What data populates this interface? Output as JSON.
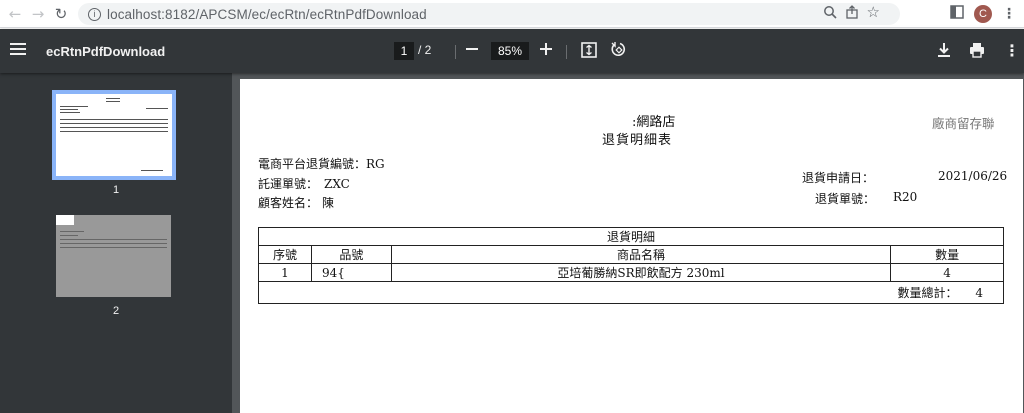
{
  "browser": {
    "url": "localhost:8182/APCSM/ec/ecRtn/ecRtnPdfDownload",
    "avatar_letter": "C"
  },
  "pdf_toolbar": {
    "title": "ecRtnPdfDownload",
    "current_page": "1",
    "total_pages": "/ 2",
    "zoom": "85%"
  },
  "sidebar": {
    "thumbnails": [
      {
        "label": "1",
        "selected": true
      },
      {
        "label": "2",
        "selected": false
      }
    ]
  },
  "document": {
    "store_name": ":網路店",
    "copy_note": "廠商留存聯",
    "heading": "退貨明細表",
    "return_no_label": "電商平台退貨編號：",
    "return_no_value": "RG",
    "shipping_no_label": "託運單號：",
    "shipping_no_value": "ZXC",
    "customer_label": "顧客姓名：",
    "customer_value": "陳",
    "apply_date_label": "退貨申請日：",
    "apply_date_value": "2021/06/26",
    "return_slip_label": "退貨單號：",
    "return_slip_value": "R20",
    "table": {
      "caption": "退貨明細",
      "headers": [
        "序號",
        "品號",
        "商品名稱",
        "數量"
      ],
      "rows": [
        [
          "1",
          "94{",
          "亞培葡勝納SR即飲配方 230ml",
          "4"
        ]
      ],
      "total_label": "數量總計：",
      "total_value": "4"
    }
  },
  "colors": {
    "toolbar_bg": "#323639",
    "viewer_bg": "#525659",
    "thumb_selected_border": "#8ab4f8"
  }
}
